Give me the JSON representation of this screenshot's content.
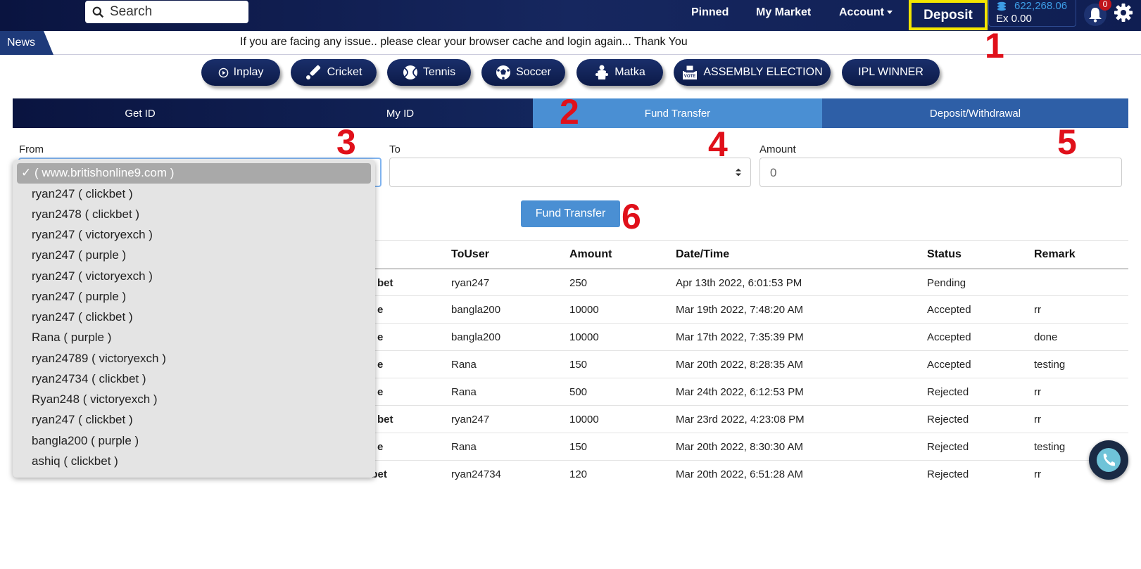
{
  "header": {
    "search_placeholder": "Search",
    "nav": [
      "Pinned",
      "My Market",
      "Account"
    ],
    "deposit_label": "Deposit",
    "balance": "622,268.06",
    "exposure": "Ex  0.00",
    "notification_count": "0"
  },
  "news": {
    "tag": "News",
    "text": "If you are facing any issue.. please clear your browser cache and login again... Thank You"
  },
  "sports": [
    "Inplay",
    "Cricket",
    "Tennis",
    "Soccer",
    "Matka",
    "ASSEMBLY ELECTION",
    "IPL WINNER"
  ],
  "tabs": [
    "Get ID",
    "My ID",
    "Fund Transfer",
    "Deposit/Withdrawal"
  ],
  "form": {
    "from_label": "From",
    "to_label": "To",
    "amount_label": "Amount",
    "amount_value": "0",
    "submit_label": "Fund Transfer"
  },
  "dropdown": {
    "selected": "✓ ( www.britishonline9.com )",
    "options": [
      "ryan247 ( clickbet )",
      "ryan2478 ( clickbet )",
      "ryan247 ( victoryexch )",
      "ryan247 ( purple )",
      "ryan247 ( victoryexch )",
      "ryan247 ( purple )",
      "ryan247 ( clickbet )",
      "Rana ( purple )",
      "ryan24789 ( victoryexch )",
      "ryan24734 ( clickbet )",
      "Ryan248 ( victoryexch )",
      "ryan247 ( clickbet )",
      "bangla200 ( purple )",
      "ashiq ( clickbet )"
    ]
  },
  "table": {
    "headers": [
      "ToUser",
      "Amount",
      "Date/Time",
      "Status",
      "Remark"
    ],
    "rows": [
      {
        "from_site": "bet",
        "to_user": "ryan247",
        "amount": "250",
        "datetime": "Apr 13th 2022, 6:01:53 PM",
        "status": "Pending",
        "remark": ""
      },
      {
        "from_site": "e",
        "to_user": "bangla200",
        "amount": "10000",
        "datetime": "Mar 19th 2022, 7:48:20 AM",
        "status": "Accepted",
        "remark": "rr"
      },
      {
        "from_site": "e",
        "to_user": "bangla200",
        "amount": "10000",
        "datetime": "Mar 17th 2022, 7:35:39 PM",
        "status": "Accepted",
        "remark": "done"
      },
      {
        "from_site": "e",
        "to_user": "Rana",
        "amount": "150",
        "datetime": "Mar 20th 2022, 8:28:35 AM",
        "status": "Accepted",
        "remark": "testing"
      },
      {
        "from_site": "e",
        "to_user": "Rana",
        "amount": "500",
        "datetime": "Mar 24th 2022, 6:12:53 PM",
        "status": "Rejected",
        "remark": "rr"
      },
      {
        "from_site": "bet",
        "to_user": "ryan247",
        "amount": "10000",
        "datetime": "Mar 23rd 2022, 4:23:08 PM",
        "status": "Rejected",
        "remark": "rr"
      },
      {
        "from_site": "e",
        "to_user": "Rana",
        "amount": "150",
        "datetime": "Mar 20th 2022, 8:30:30 AM",
        "status": "Rejected",
        "remark": "testing"
      },
      {
        "from_site": "clickbet",
        "to_user": "ryan24734",
        "amount": "120",
        "datetime": "Mar 20th 2022, 6:51:28 AM",
        "status": "Rejected",
        "remark": "rr"
      }
    ]
  },
  "markers": [
    "1",
    "2",
    "3",
    "4",
    "5",
    "6"
  ],
  "colors": {
    "accent": "#4a8fd3",
    "navy": "#0a1440",
    "highlight": "#f3e500",
    "marker": "#e0101a"
  }
}
